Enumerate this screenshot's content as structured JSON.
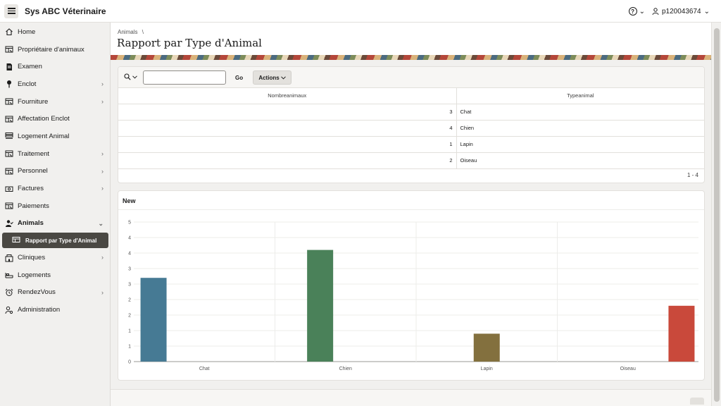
{
  "header": {
    "app_title": "Sys ABC Véterinaire",
    "help_icon": "?",
    "help_chevron": "⌄",
    "user_name": "p120043674",
    "user_chevron": "⌄"
  },
  "sidebar": {
    "items": [
      {
        "label": "Home",
        "icon": "home-icon",
        "chevron": ""
      },
      {
        "label": "Propriétaire d'animaux",
        "icon": "report-icon",
        "chevron": ""
      },
      {
        "label": "Examen",
        "icon": "document-icon",
        "chevron": ""
      },
      {
        "label": "Enclot",
        "icon": "pin-icon",
        "chevron": "›"
      },
      {
        "label": "Fourniture",
        "icon": "report-icon",
        "chevron": "›"
      },
      {
        "label": "Affectation Enclot",
        "icon": "report-icon",
        "chevron": ""
      },
      {
        "label": "Logement Animal",
        "icon": "list-icon",
        "chevron": ""
      },
      {
        "label": "Traitement",
        "icon": "report-icon",
        "chevron": "›"
      },
      {
        "label": "Personnel",
        "icon": "report-icon",
        "chevron": "›"
      },
      {
        "label": "Factures",
        "icon": "money-icon",
        "chevron": "›"
      },
      {
        "label": "Paiements",
        "icon": "report-icon",
        "chevron": ""
      },
      {
        "label": "Animals",
        "icon": "user-check-icon",
        "chevron": "⌄"
      }
    ],
    "sub_item": {
      "label": "Rapport par Type d'Animal",
      "icon": "table-icon"
    },
    "items_after": [
      {
        "label": "Cliniques",
        "icon": "building-icon",
        "chevron": "›"
      },
      {
        "label": "Logements",
        "icon": "bed-icon",
        "chevron": ""
      },
      {
        "label": "RendezVous",
        "icon": "alarm-icon",
        "chevron": "›"
      },
      {
        "label": "Administration",
        "icon": "user-gear-icon",
        "chevron": ""
      }
    ]
  },
  "breadcrumb": {
    "item": "Animals",
    "separator": "\\"
  },
  "page": {
    "title": "Rapport par Type d'Animal"
  },
  "report": {
    "search": {
      "value": "",
      "placeholder": ""
    },
    "go_label": "Go",
    "actions_label": "Actions",
    "columns": [
      "Nombreanimaux",
      "Typeanimal"
    ],
    "rows": [
      {
        "count": "3",
        "type": "Chat"
      },
      {
        "count": "4",
        "type": "Chien"
      },
      {
        "count": "1",
        "type": "Lapin"
      },
      {
        "count": "2",
        "type": "Oiseau"
      }
    ],
    "pagination": "1 - 4"
  },
  "chart_data": {
    "type": "bar",
    "title": "New",
    "categories": [
      "Chat",
      "Chien",
      "Lapin",
      "Oiseau"
    ],
    "values": [
      3,
      4,
      1,
      2
    ],
    "colors": [
      "#467a94",
      "#4a8159",
      "#83703e",
      "#c9493b"
    ],
    "ylim": [
      0,
      5
    ],
    "yticks": [
      "0",
      "1",
      "1",
      "2",
      "2",
      "3",
      "3",
      "4",
      "4",
      "5"
    ],
    "grid": true,
    "xlabel": "",
    "ylabel": ""
  }
}
